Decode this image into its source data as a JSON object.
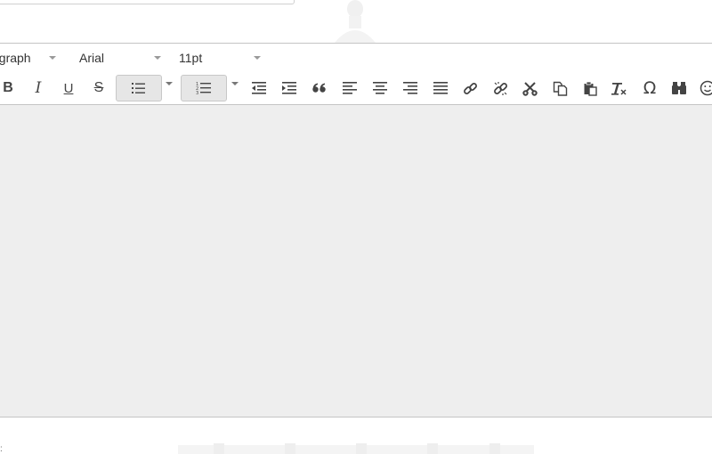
{
  "toolbar": {
    "format_select": "agraph",
    "font_family_select": "Arial",
    "font_size_select": "11pt"
  },
  "icons": {
    "bold": "bold-icon",
    "italic": "italic-icon",
    "underline": "underline-icon",
    "strikethrough": "strikethrough-icon",
    "bullet_list": "bullet-list-icon",
    "numbered_list": "numbered-list-icon",
    "outdent": "outdent-icon",
    "indent": "indent-icon",
    "blockquote": "blockquote-icon",
    "align_left": "align-left-icon",
    "align_center": "align-center-icon",
    "align_right": "align-right-icon",
    "align_justify": "align-justify-icon",
    "link": "link-icon",
    "unlink": "unlink-icon",
    "cut": "scissors-icon",
    "copy": "copy-icon",
    "paste": "paste-icon",
    "clear_formatting": "clear-formatting-icon",
    "special_char": "omega-icon",
    "find": "binoculars-icon",
    "emoticons": "emoticon-icon"
  },
  "glyphs": {
    "bold": "B",
    "italic": "I",
    "underline": "U",
    "strikethrough": "S",
    "omega": "Ω",
    "below_marker": ":"
  },
  "colors": {
    "content_bg": "#eeeeee",
    "border": "#c5c5c5",
    "icon": "#444444",
    "pressed_bg": "#e6e6e6"
  }
}
